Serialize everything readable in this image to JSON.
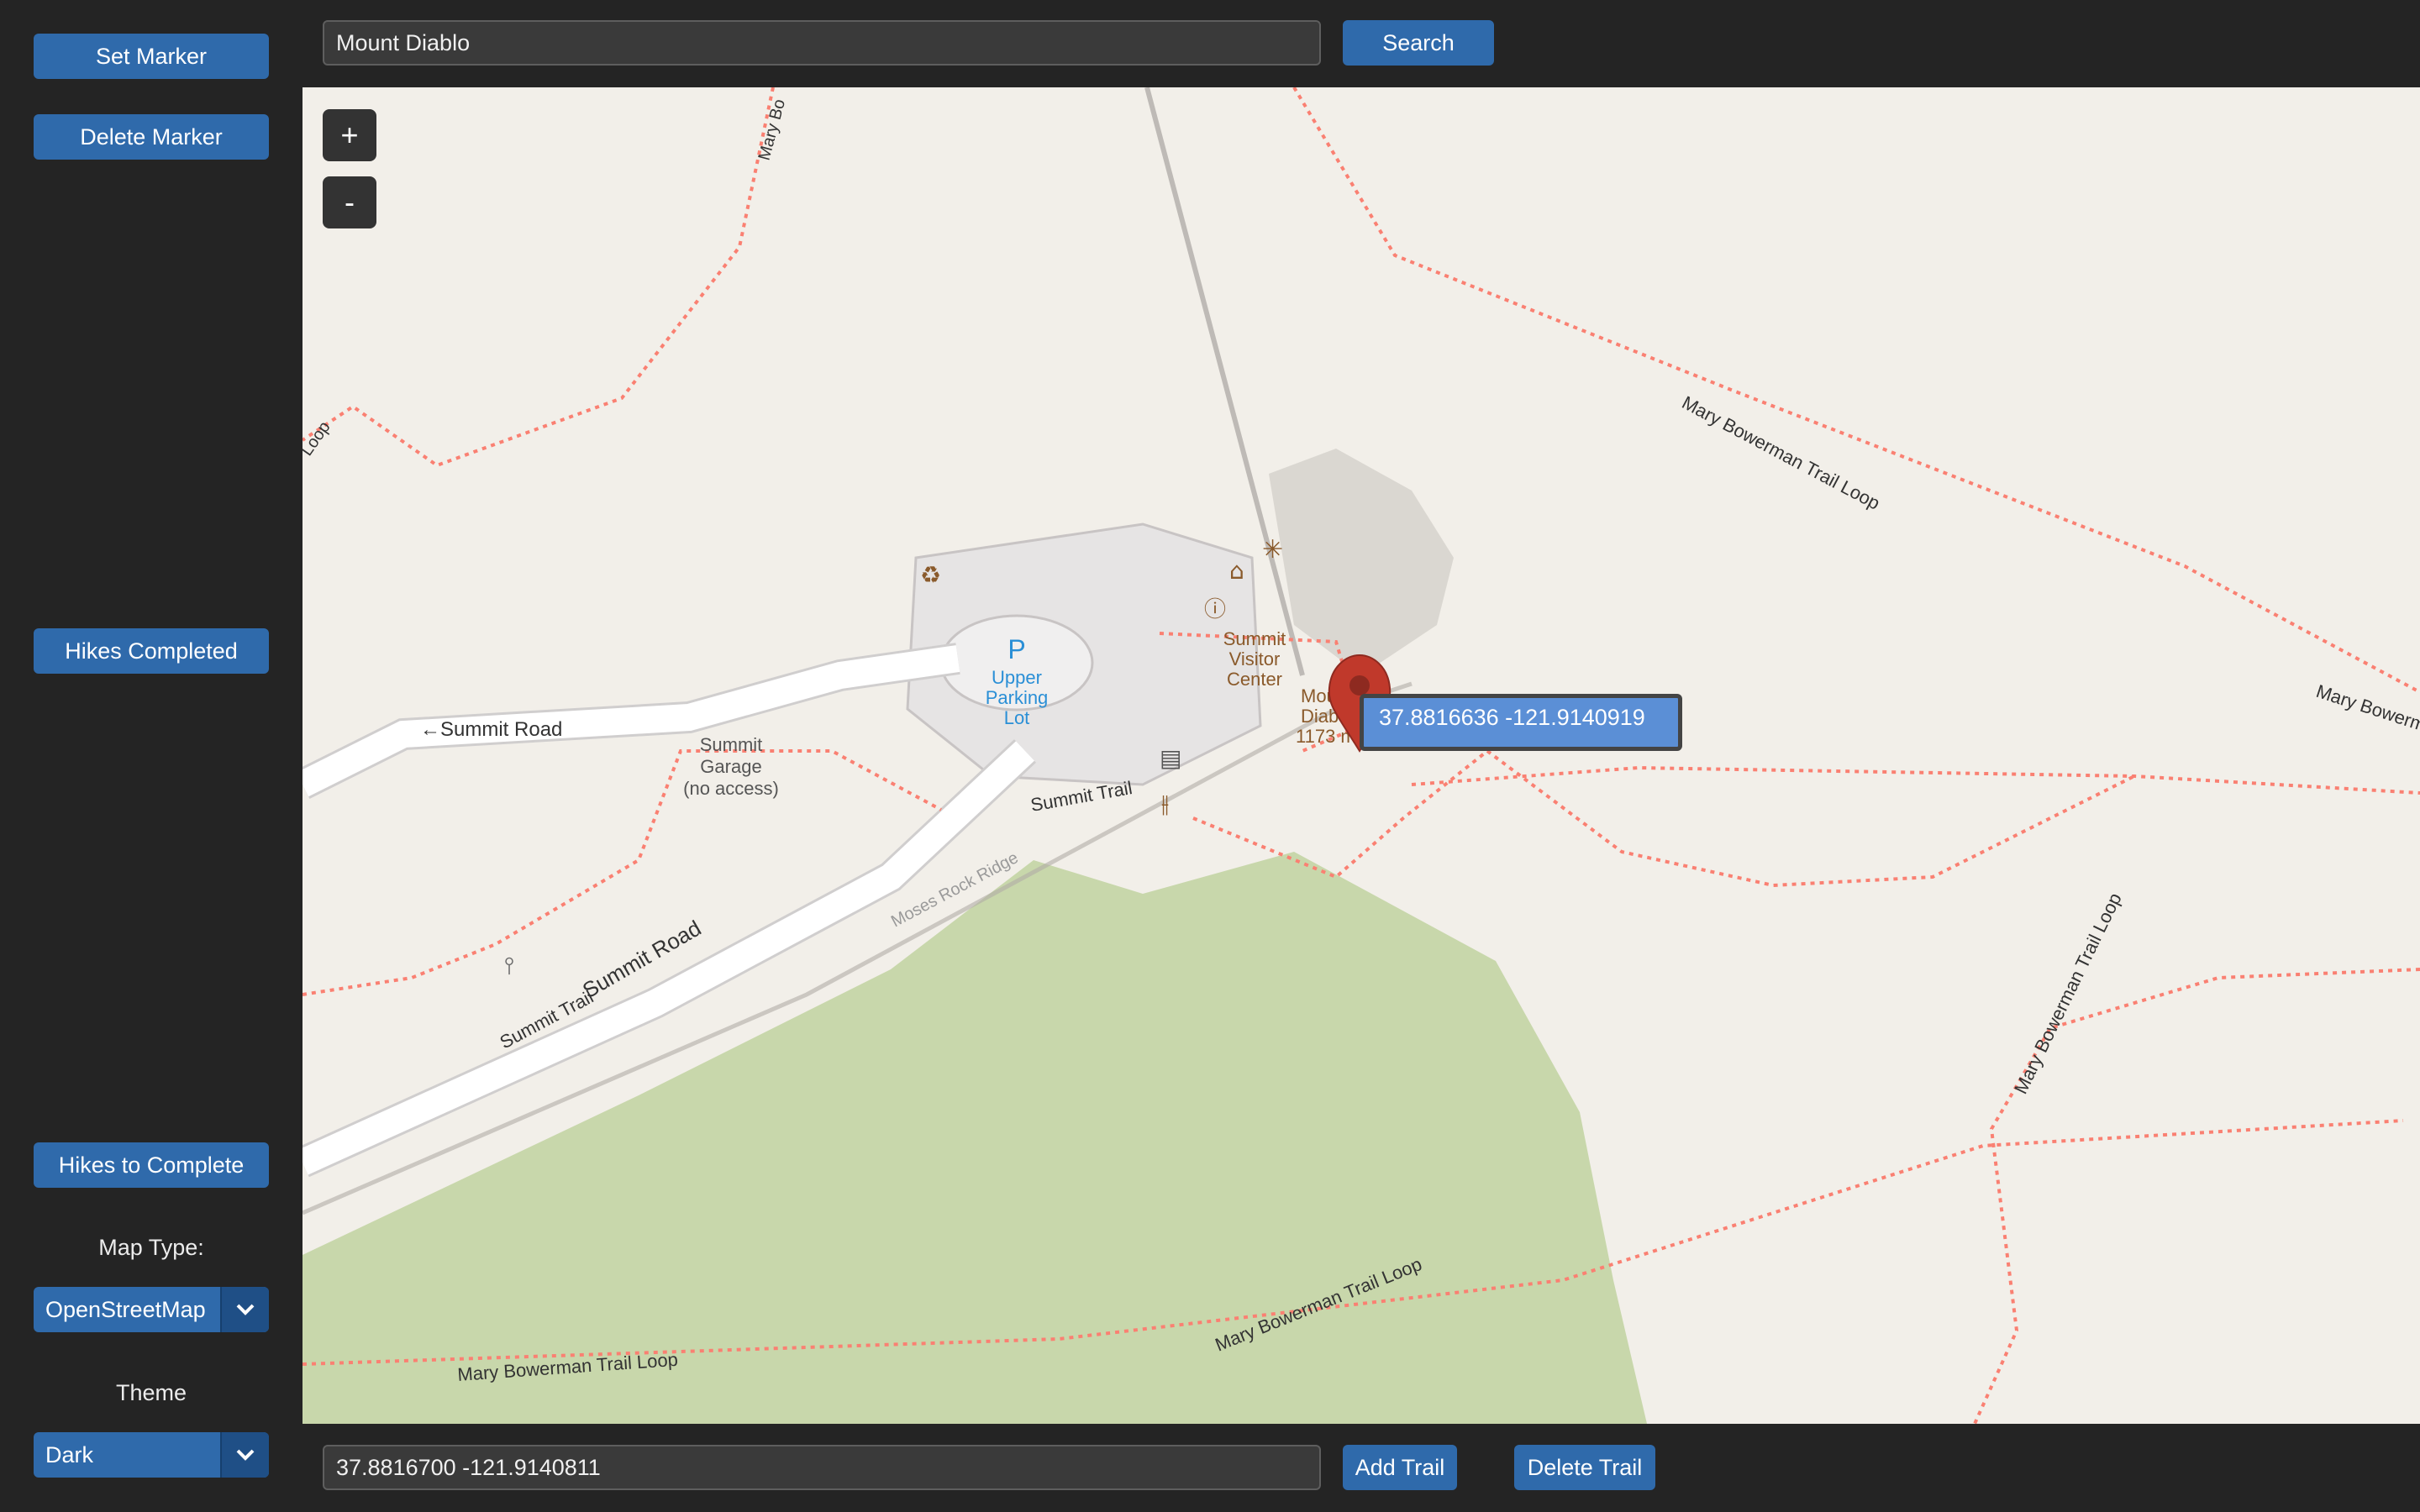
{
  "sidebar": {
    "set_marker": "Set Marker",
    "delete_marker": "Delete Marker",
    "hikes_completed": "Hikes Completed",
    "hikes_to_complete": "Hikes to Complete",
    "map_type_label": "Map Type:",
    "map_type_value": "OpenStreetMap",
    "theme_label": "Theme",
    "theme_value": "Dark"
  },
  "topbar": {
    "search_value": "Mount Diablo",
    "search_button": "Search"
  },
  "bottombar": {
    "coords_value": "37.8816700 -121.9140811",
    "add_trail": "Add Trail",
    "delete_trail": "Delete Trail"
  },
  "map": {
    "zoom_in": "+",
    "zoom_out": "-",
    "marker_tooltip": "37.8816636 -121.9140919",
    "labels": {
      "summit_road_1": "←Summit Road",
      "summit_road_2": "Summit Road",
      "summit_trail_1": "Summit Trail",
      "summit_trail_2": "Summit Trail",
      "summit_garage_1": "Summit",
      "summit_garage_2": "Garage",
      "summit_garage_3": "(no access)",
      "parking_p": "P",
      "parking_1": "Upper",
      "parking_2": "Parking",
      "parking_3": "Lot",
      "visitor_1": "Summit",
      "visitor_2": "Visitor",
      "visitor_3": "Center",
      "peak_1": "Mou",
      "peak_2": "Diab",
      "peak_3": "1173 m",
      "moses_rock": "Moses Rock Ridge",
      "mary_loop_1": "Mary Bowerman Trail Loop",
      "mary_loop_2": "Mary Bowerm",
      "mary_loop_3": "Mary Bowerman Trail Loop",
      "mary_loop_4": "Mary Bowerman Trail Loop",
      "mary_loop_5": "Mary Bowerman Trail Loop",
      "mary_b_top": "Mary Bo",
      "loop_left": "Loop"
    }
  },
  "colors": {
    "accent": "#2f6aab",
    "background": "#242424",
    "map_land": "#f2efe9",
    "forest": "#c8d7ab",
    "trail": "#fa8072",
    "marker": "#c0392b"
  }
}
